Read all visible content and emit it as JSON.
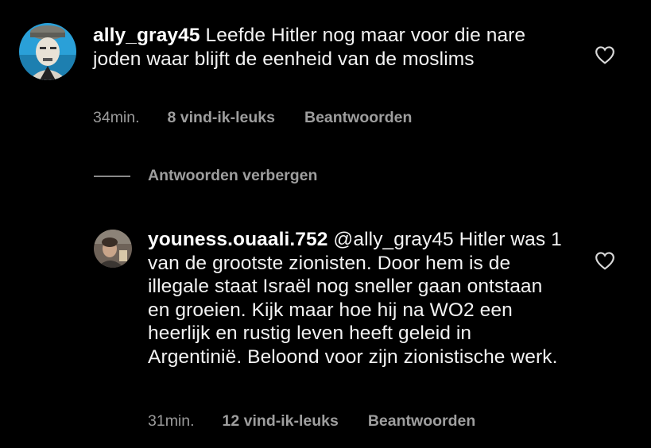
{
  "comments": [
    {
      "username": "ally_gray45",
      "text": " Leefde Hitler nog maar voor die nare joden waar blijft de eenheid van de moslims",
      "time": "34min.",
      "likes": "8 vind-ik-leuks",
      "reply_label": "Beantwoorden",
      "icon": "heart-outline-icon"
    },
    {
      "username": "youness.ouaali.752",
      "text": " @ally_gray45 Hitler was 1 van de grootste zionisten. Door hem is de illegale staat Israël nog sneller gaan ontstaan en groeien. Kijk maar hoe hij na WO2 een heerlijk en rustig leven heeft geleid in Argentinië. Beloond voor zijn zionistische werk.",
      "time": "31min.",
      "likes": "12 vind-ik-leuks",
      "reply_label": "Beantwoorden",
      "icon": "heart-outline-icon"
    }
  ],
  "hide_replies_label": "Antwoorden verbergen",
  "colors": {
    "background": "#000000",
    "text": "#f3f3f3",
    "meta": "#9a9a9a"
  }
}
